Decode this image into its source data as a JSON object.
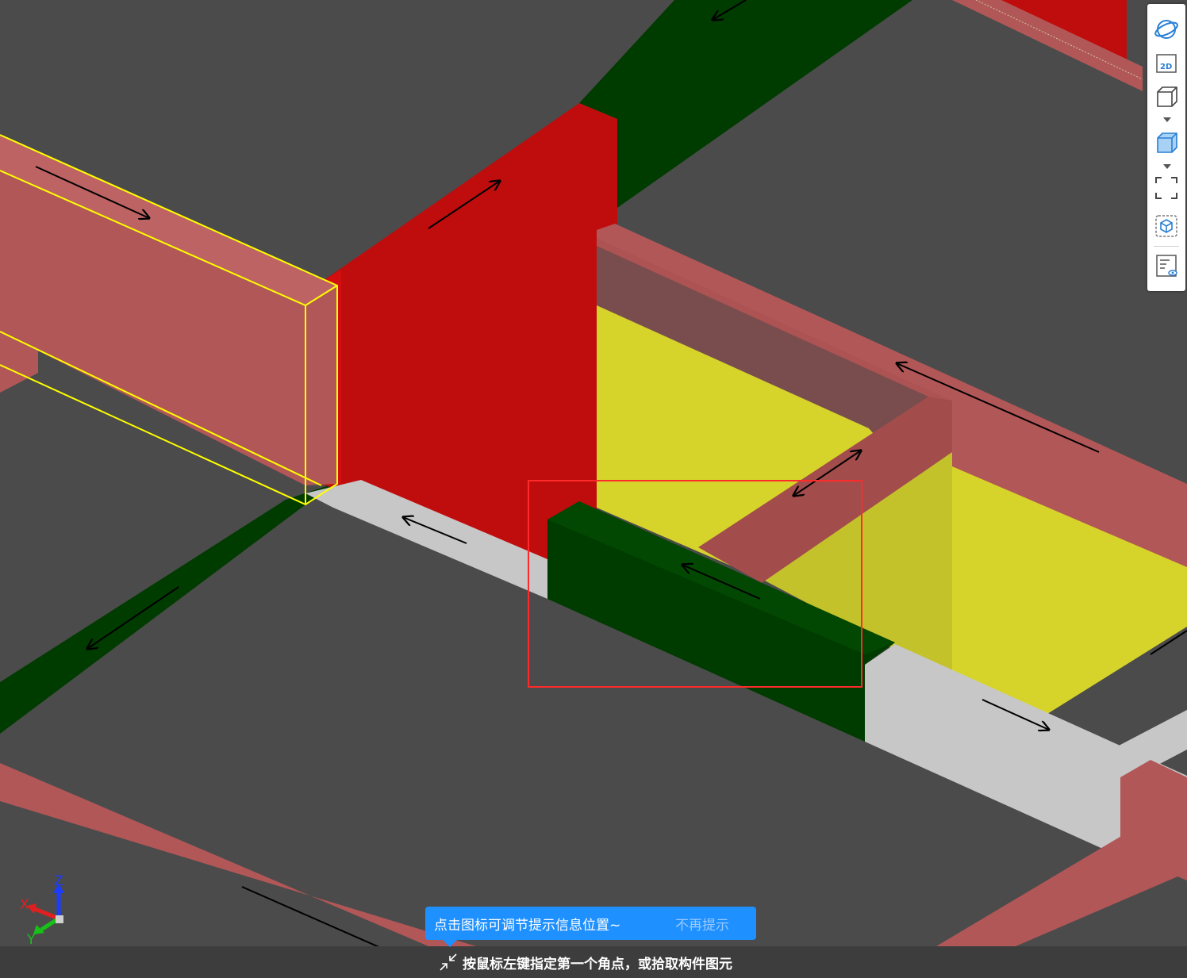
{
  "scene": {
    "colors": {
      "background": "#4b4b4b",
      "beam_pink": "#b25757",
      "wall_red": "#bf0d0d",
      "green_beam": "#003b00",
      "slab_yellow": "#d6d42a",
      "grey_beam": "#c7c7c7",
      "selection_yellow": "#ffff00",
      "selection_rect": "#ff2a2a"
    }
  },
  "toolbar": {
    "buttons": [
      {
        "name": "orbit-icon"
      },
      {
        "name": "2d-view-icon",
        "label": "2D"
      },
      {
        "name": "3d-box-icon"
      },
      {
        "name": "shaded-box-icon"
      },
      {
        "name": "fullscreen-icon"
      },
      {
        "name": "component-view-icon"
      },
      {
        "name": "properties-view-icon"
      }
    ]
  },
  "tip": {
    "text": "点击图标可调节提示信息位置~",
    "dismiss": "不再提示"
  },
  "status": {
    "prompt": "按鼠标左键指定第一个角点，或拾取构件图元"
  },
  "axes": {
    "x": "X",
    "y": "Y",
    "z": "Z"
  }
}
